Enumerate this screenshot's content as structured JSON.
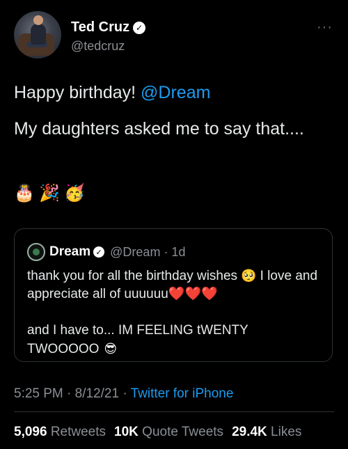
{
  "author": {
    "name": "Ted Cruz",
    "handle": "@tedcruz",
    "verified": true,
    "more_icon": "ellipsis-icon"
  },
  "tweet": {
    "line1_text": "Happy birthday! ",
    "line1_mention": "@Dream",
    "line2": "My daughters asked me to say that....",
    "emojis": [
      "🎂",
      "🎉",
      "🥳"
    ]
  },
  "quote": {
    "name": "Dream",
    "verified": true,
    "handle_time": "@Dream · 1d",
    "line1_a": "thank you for all the birthday wishes ",
    "emoji_pleading": "🥺",
    "line1_b": " I love and appreciate all of uuuuuu",
    "hearts": "❤️❤️❤️",
    "line2": "and I have to... IM FEELING tWENTY TWOOOOO ",
    "emoji_cool": "😎"
  },
  "meta": {
    "timestamp": "5:25 PM · 8/12/21 · ",
    "source": "Twitter for iPhone"
  },
  "stats": {
    "retweets_count": "5,096",
    "retweets_label": "Retweets",
    "quotes_count": "10K",
    "quotes_label": "Quote Tweets",
    "likes_count": "29.4K",
    "likes_label": "Likes"
  },
  "colors": {
    "background": "#000000",
    "link": "#1d9bf0",
    "secondary_text": "#8b8f94",
    "heart": "#f4212e"
  }
}
